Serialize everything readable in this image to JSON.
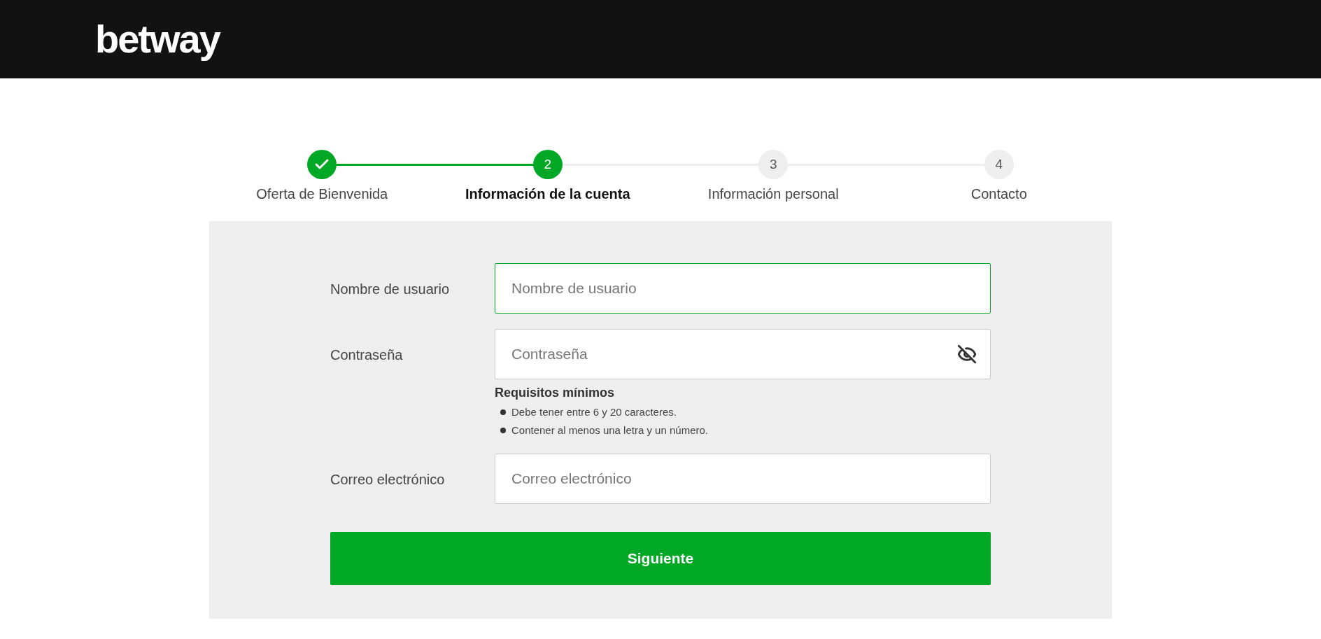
{
  "header": {
    "logo": "betway"
  },
  "steps": [
    {
      "label": "Oferta de Bienvenida",
      "done": true,
      "selected": false
    },
    {
      "number": "2",
      "label": "Información de la cuenta",
      "done": false,
      "selected": true
    },
    {
      "number": "3",
      "label": "Información personal",
      "done": false,
      "selected": false
    },
    {
      "number": "4",
      "label": "Contacto",
      "done": false,
      "selected": false
    }
  ],
  "form": {
    "fields": [
      {
        "kind": "text",
        "label": "Nombre de usuario",
        "placeholder": "Nombre de usuario",
        "focused": true
      },
      {
        "kind": "password",
        "label": "Contraseña",
        "placeholder": "Contraseña",
        "focused": false,
        "requirements": {
          "title": "Requisitos mínimos",
          "items": [
            "Debe tener entre 6 y 20 caracteres.",
            "Contener al menos una letra y un número."
          ]
        }
      },
      {
        "kind": "email",
        "label": "Correo electrónico",
        "placeholder": "Correo electrónico",
        "focused": false
      }
    ],
    "submit": "Siguiente"
  }
}
